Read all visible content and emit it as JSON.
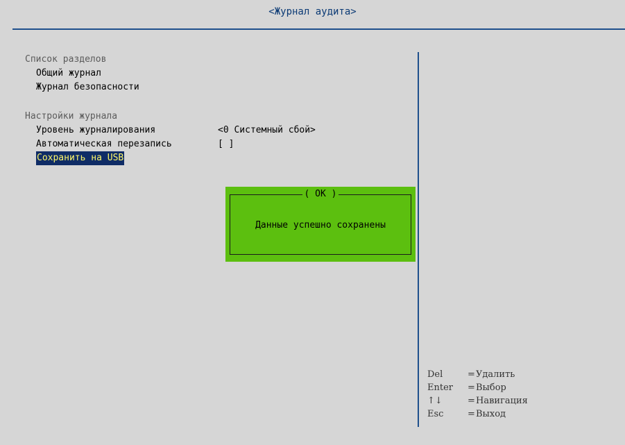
{
  "window": {
    "title": "<Журнал аудита>"
  },
  "sections": [
    {
      "label": "Список разделов",
      "items": [
        {
          "label": "Общий журнал"
        },
        {
          "label": "Журнал безопасности"
        }
      ]
    },
    {
      "label": "Настройки журнала",
      "items": [
        {
          "label": "Уровень журналирования",
          "value": "<0 Системный сбой>"
        },
        {
          "label": "Автоматическая перезапись",
          "value": "[ ]"
        },
        {
          "label": "Сохранить на USB",
          "selected": true
        }
      ]
    }
  ],
  "dialog": {
    "title": "( OK )",
    "message": "Данные успешно сохранены"
  },
  "help": [
    {
      "key": "Del",
      "action": "Удалить"
    },
    {
      "key": "Enter",
      "action": "Выбор"
    },
    {
      "key": "↑↓",
      "action": "Навигация"
    },
    {
      "key": "Esc",
      "action": "Выход"
    }
  ],
  "colors": {
    "background": "#d6d6d6",
    "title_text": "#0b3a75",
    "rule": "#1e4f8c",
    "dialog_bg": "#5cbf0f",
    "selected_bg": "#0f2c66",
    "selected_fg": "#fff86a"
  }
}
